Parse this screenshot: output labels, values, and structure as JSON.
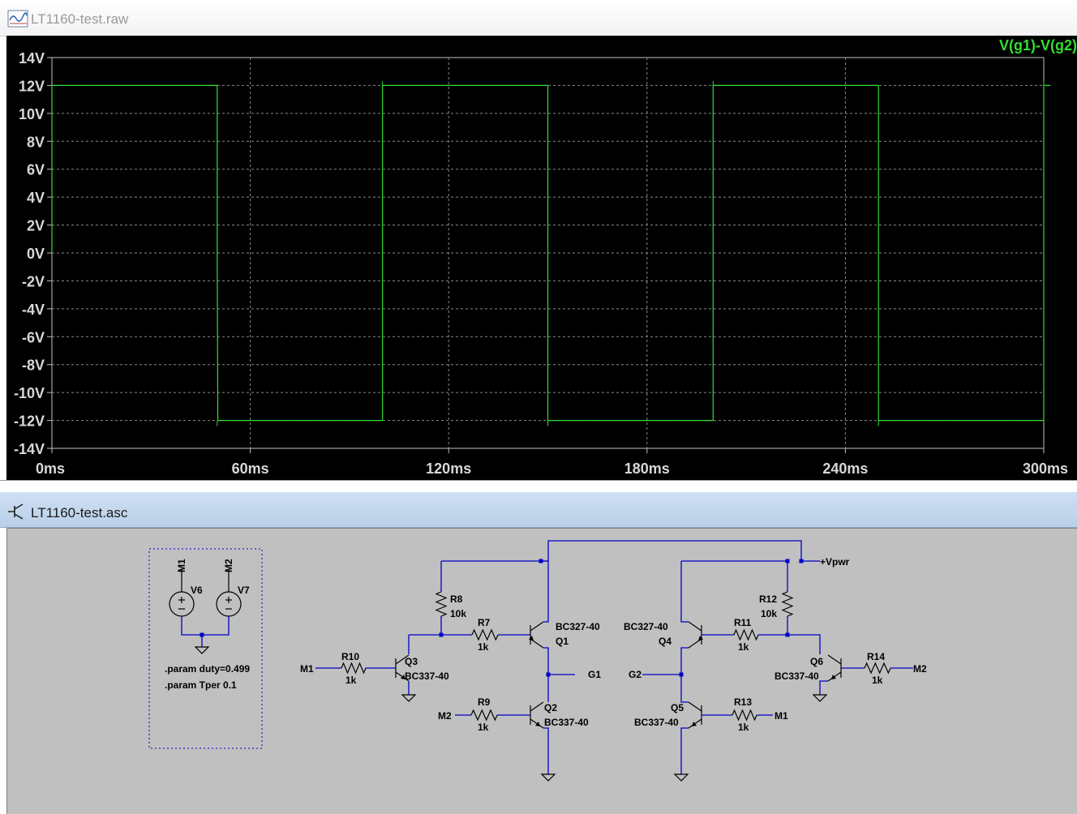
{
  "plot_window": {
    "title": "LT1160-test.raw",
    "trace_label": "V(g1)-V(g2)",
    "trace_color": "#33dd33",
    "background": "#000000"
  },
  "schematic_window": {
    "title": "LT1160-test.asc",
    "wire_color": "#0000c8",
    "background": "#c0c0c0",
    "labels": {
      "m1_src": "M1",
      "m2_src": "M2",
      "v6": "V6",
      "v7": "V7",
      "param1": ".param duty=0.499",
      "param2": ".param Tper 0.1",
      "m1_r10": "M1",
      "r10": "R10",
      "r10_val": "1k",
      "q3": "Q3",
      "q3_model": "BC337-40",
      "r8": "R8",
      "r8_val": "10k",
      "r7": "R7",
      "r7_val": "1k",
      "q1_model": "BC327-40",
      "q1": "Q1",
      "g1": "G1",
      "m2_r9": "M2",
      "r9": "R9",
      "r9_val": "1k",
      "q2": "Q2",
      "q2_model": "BC337-40",
      "vpwr": "+Vpwr",
      "q4_model": "BC327-40",
      "q4": "Q4",
      "r11": "R11",
      "r11_val": "1k",
      "r12": "R12",
      "r12_val": "10k",
      "q6": "Q6",
      "q6_model": "BC337-40",
      "r14": "R14",
      "r14_val": "1k",
      "m2_r14": "M2",
      "g2": "G2",
      "q5": "Q5",
      "q5_model": "BC337-40",
      "r13": "R13",
      "r13_val": "1k",
      "m1_r13": "M1"
    }
  },
  "chart_data": {
    "type": "line",
    "title": "",
    "xlabel": "",
    "ylabel": "",
    "xlim": [
      0,
      300
    ],
    "ylim": [
      -14,
      14
    ],
    "x_ticks": [
      "0ms",
      "60ms",
      "120ms",
      "180ms",
      "240ms",
      "300ms"
    ],
    "y_ticks": [
      "14V",
      "12V",
      "10V",
      "8V",
      "6V",
      "4V",
      "2V",
      "0V",
      "-2V",
      "-4V",
      "-6V",
      "-8V",
      "-10V",
      "-12V",
      "-14V"
    ],
    "grid": true,
    "legend": "top-right",
    "series": [
      {
        "name": "V(g1)-V(g2)",
        "color": "#33dd33",
        "x": [
          0,
          0,
          50,
          50,
          50.2,
          100,
          100,
          150,
          150,
          200,
          200,
          250,
          250,
          300,
          300,
          302
        ],
        "y": [
          0,
          12,
          12,
          0,
          -12,
          -12,
          12,
          12,
          -12,
          -12,
          12,
          12,
          -12,
          -12,
          12,
          12
        ]
      }
    ]
  }
}
